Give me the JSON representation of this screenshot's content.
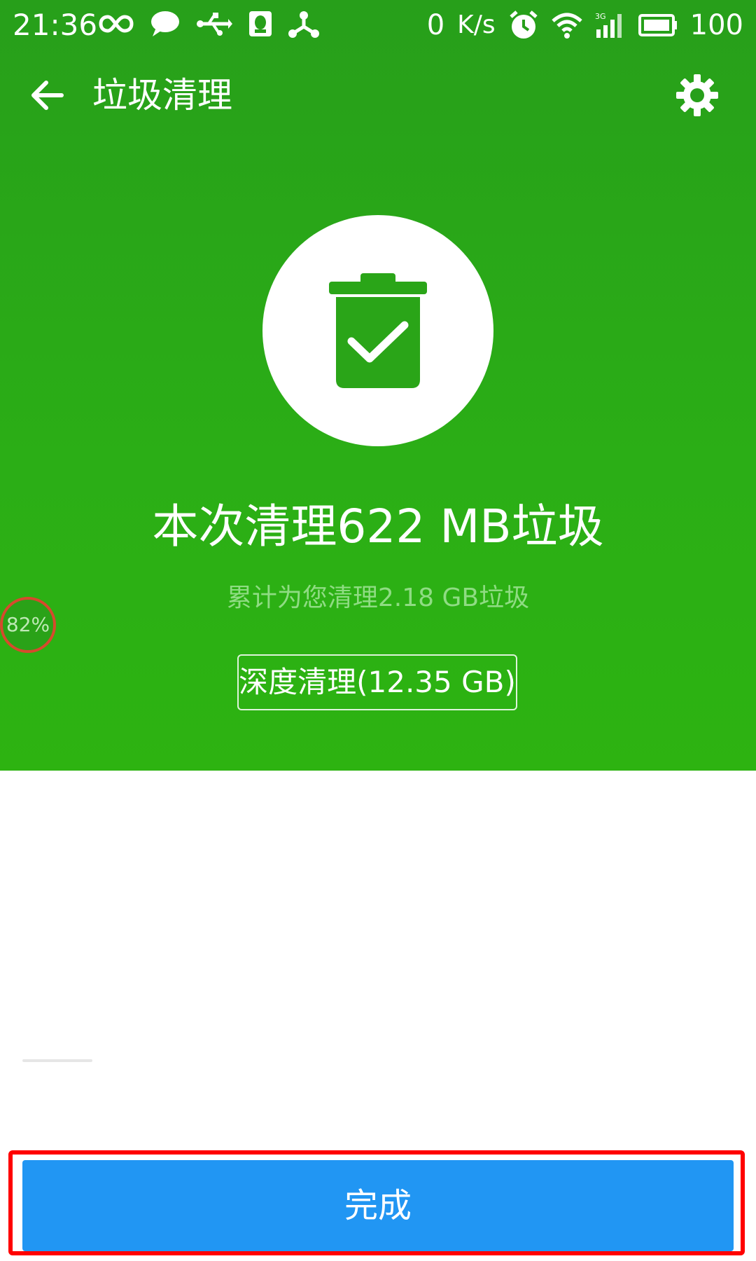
{
  "status_bar": {
    "time": "21:36",
    "speed_value": "0",
    "speed_unit": "K/s",
    "battery": "100"
  },
  "app_bar": {
    "title": "垃圾清理"
  },
  "result": {
    "title": "本次清理622 MB垃圾",
    "subtitle": "累计为您清理2.18 GB垃圾",
    "deep_clean_label": "深度清理(12.35 GB)"
  },
  "memory_badge": {
    "percent": "82%"
  },
  "footer": {
    "done_label": "完成"
  },
  "colors": {
    "hero_green": "#2bae16",
    "primary_blue": "#2196f3",
    "highlight_red": "#ff0000"
  }
}
